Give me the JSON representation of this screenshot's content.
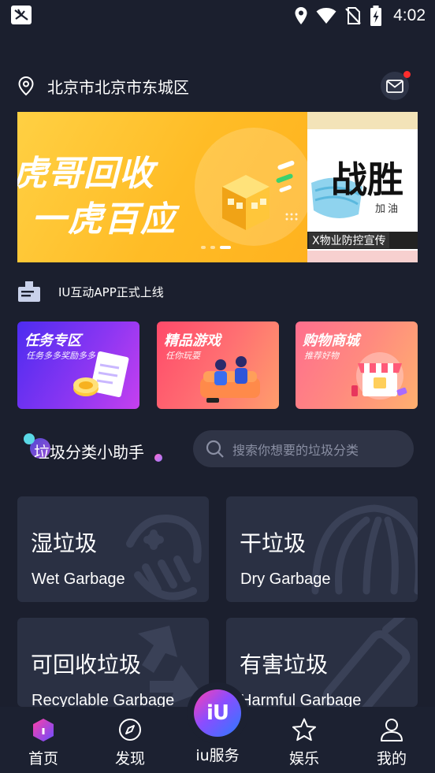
{
  "status_bar": {
    "time": "4:02",
    "icons": [
      "app-notification-icon",
      "location-icon",
      "wifi-icon",
      "no-sim-icon",
      "battery-charging-icon"
    ]
  },
  "location": {
    "text": "北京市北京市东城区",
    "has_unread_message": true
  },
  "banner": {
    "left_line1": "虎哥回收",
    "left_line2": "一虎百应",
    "right_big": "战胜",
    "right_small": "加油",
    "right_bar": "X物业防控宣传",
    "active_index": 2,
    "page_count": 3
  },
  "notice": {
    "text": "IU互动APP正式上线"
  },
  "features": [
    {
      "title": "任务专区",
      "subtitle": "任务多多奖励多多",
      "color_from": "#5b2df5",
      "color_to": "#c03ff2"
    },
    {
      "title": "精品游戏",
      "subtitle": "任你玩耍",
      "color_from": "#ff4f6d",
      "color_to": "#ff9a6a"
    },
    {
      "title": "购物商城",
      "subtitle": "推荐好物",
      "color_from": "#ff7a8a",
      "color_to": "#ffa973"
    }
  ],
  "garbage": {
    "title": "垃圾分类小助手",
    "search_placeholder": "搜索你想要的垃圾分类",
    "categories": [
      {
        "cn": "湿垃圾",
        "en": "Wet Garbage"
      },
      {
        "cn": "干垃圾",
        "en": "Dry Garbage"
      },
      {
        "cn": "可回收垃圾",
        "en": "Recyclable Garbage"
      },
      {
        "cn": "有害垃圾",
        "en": "Harmful Garbage"
      }
    ]
  },
  "nav": {
    "items": [
      {
        "label": "首页",
        "icon": "home-icon",
        "active": true
      },
      {
        "label": "发现",
        "icon": "compass-icon",
        "active": false
      },
      {
        "label": "iu服务",
        "icon": "iu-logo-icon",
        "active": false
      },
      {
        "label": "娱乐",
        "icon": "star-icon",
        "active": false
      },
      {
        "label": "我的",
        "icon": "user-icon",
        "active": false
      }
    ],
    "center_logo": "iU"
  },
  "colors": {
    "background": "#1b1f2e",
    "card": "#2a3043",
    "search": "#2f3446",
    "accent_red": "#ff2d2d"
  }
}
